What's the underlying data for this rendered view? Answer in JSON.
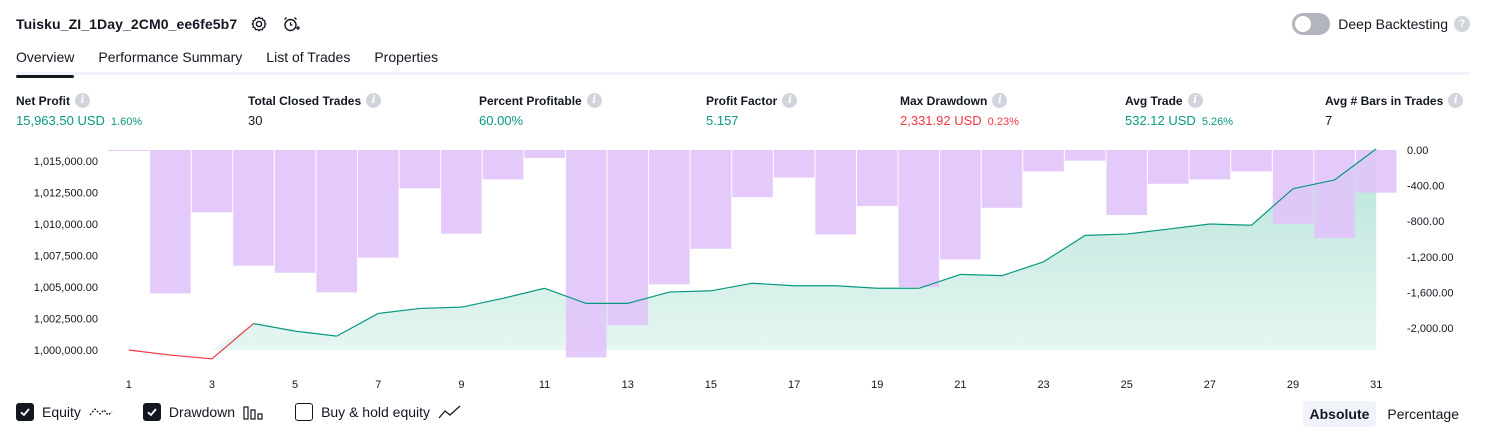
{
  "header": {
    "strategy_name": "Tuisku_ZI_1Day_2CM0_ee6fe5b7",
    "deep_backtesting_label": "Deep Backtesting",
    "deep_backtesting_enabled": false
  },
  "tabs": [
    {
      "label": "Overview",
      "active": true
    },
    {
      "label": "Performance Summary",
      "active": false
    },
    {
      "label": "List of Trades",
      "active": false
    },
    {
      "label": "Properties",
      "active": false
    }
  ],
  "metrics": [
    {
      "label": "Net Profit",
      "value": "15,963.50 USD",
      "pct": "1.60%",
      "tone": "green"
    },
    {
      "label": "Total Closed Trades",
      "value": "30",
      "pct": "",
      "tone": "dark"
    },
    {
      "label": "Percent Profitable",
      "value": "60.00%",
      "pct": "",
      "tone": "green"
    },
    {
      "label": "Profit Factor",
      "value": "5.157",
      "pct": "",
      "tone": "green"
    },
    {
      "label": "Max Drawdown",
      "value": "2,331.92 USD",
      "pct": "0.23%",
      "tone": "red"
    },
    {
      "label": "Avg Trade",
      "value": "532.12 USD",
      "pct": "5.26%",
      "tone": "green"
    },
    {
      "label": "Avg # Bars in Trades",
      "value": "7",
      "pct": "",
      "tone": "dark"
    }
  ],
  "footer": {
    "equity_label": "Equity",
    "equity_checked": true,
    "drawdown_label": "Drawdown",
    "drawdown_checked": true,
    "buyhold_label": "Buy & hold equity",
    "buyhold_checked": false,
    "absolute_label": "Absolute",
    "percentage_label": "Percentage",
    "mode": "absolute"
  },
  "colors": {
    "equity_up": "#089981",
    "equity_down": "#f23645",
    "equity_fill": "#d3efe8",
    "drawdown_bar": "#e1c4fb",
    "text": "#131722",
    "muted": "#d1d4dc"
  },
  "chart_data": {
    "type": "area",
    "x_ticks": [
      1,
      3,
      5,
      7,
      9,
      11,
      13,
      15,
      17,
      19,
      21,
      23,
      25,
      27,
      29,
      31
    ],
    "equity": {
      "name": "Equity",
      "x": [
        1,
        2,
        3,
        4,
        5,
        6,
        7,
        8,
        9,
        10,
        11,
        12,
        13,
        14,
        15,
        16,
        17,
        18,
        19,
        20,
        21,
        22,
        23,
        24,
        25,
        26,
        27,
        28,
        29,
        30,
        31
      ],
      "values": [
        1000000,
        999600,
        999300,
        1002100,
        1001500,
        1001100,
        1002900,
        1003300,
        1003400,
        1004100,
        1004900,
        1003700,
        1003700,
        1004600,
        1004700,
        1005300,
        1005100,
        1005100,
        1004900,
        1004900,
        1006000,
        1005900,
        1007000,
        1009100,
        1009200,
        1009600,
        1010000,
        1009900,
        1012800,
        1013500,
        1015964
      ],
      "left_axis_ticks": [
        "1,015,000.00",
        "1,012,500.00",
        "1,010,000.00",
        "1,007,500.00",
        "1,005,000.00",
        "1,002,500.00",
        "1,000,000.00"
      ],
      "left_axis_values": [
        1015000,
        1012500,
        1010000,
        1007500,
        1005000,
        1002500,
        1000000
      ],
      "ylim": [
        999200,
        1016200
      ]
    },
    "drawdown": {
      "name": "Drawdown",
      "x": [
        1,
        2,
        3,
        4,
        5,
        6,
        7,
        8,
        9,
        10,
        11,
        12,
        13,
        14,
        15,
        16,
        17,
        18,
        19,
        20,
        21,
        22,
        23,
        24,
        25,
        26,
        27,
        28,
        29,
        30,
        31
      ],
      "values": [
        -5,
        -1610,
        -700,
        -1300,
        -1380,
        -1600,
        -1210,
        -430,
        -940,
        -330,
        -90,
        -2330,
        -1970,
        -1510,
        -1110,
        -530,
        -310,
        -950,
        -630,
        -1540,
        -1230,
        -650,
        -240,
        -120,
        -730,
        -380,
        -330,
        -240,
        -830,
        -990,
        -480
      ],
      "right_axis_ticks": [
        "0.00",
        "-400.00",
        "-800.00",
        "-1,200.00",
        "-1,600.00",
        "-2,000.00"
      ],
      "right_axis_values": [
        0,
        -400,
        -800,
        -1200,
        -1600,
        -2000
      ],
      "ylim": [
        -2330,
        0
      ]
    }
  }
}
